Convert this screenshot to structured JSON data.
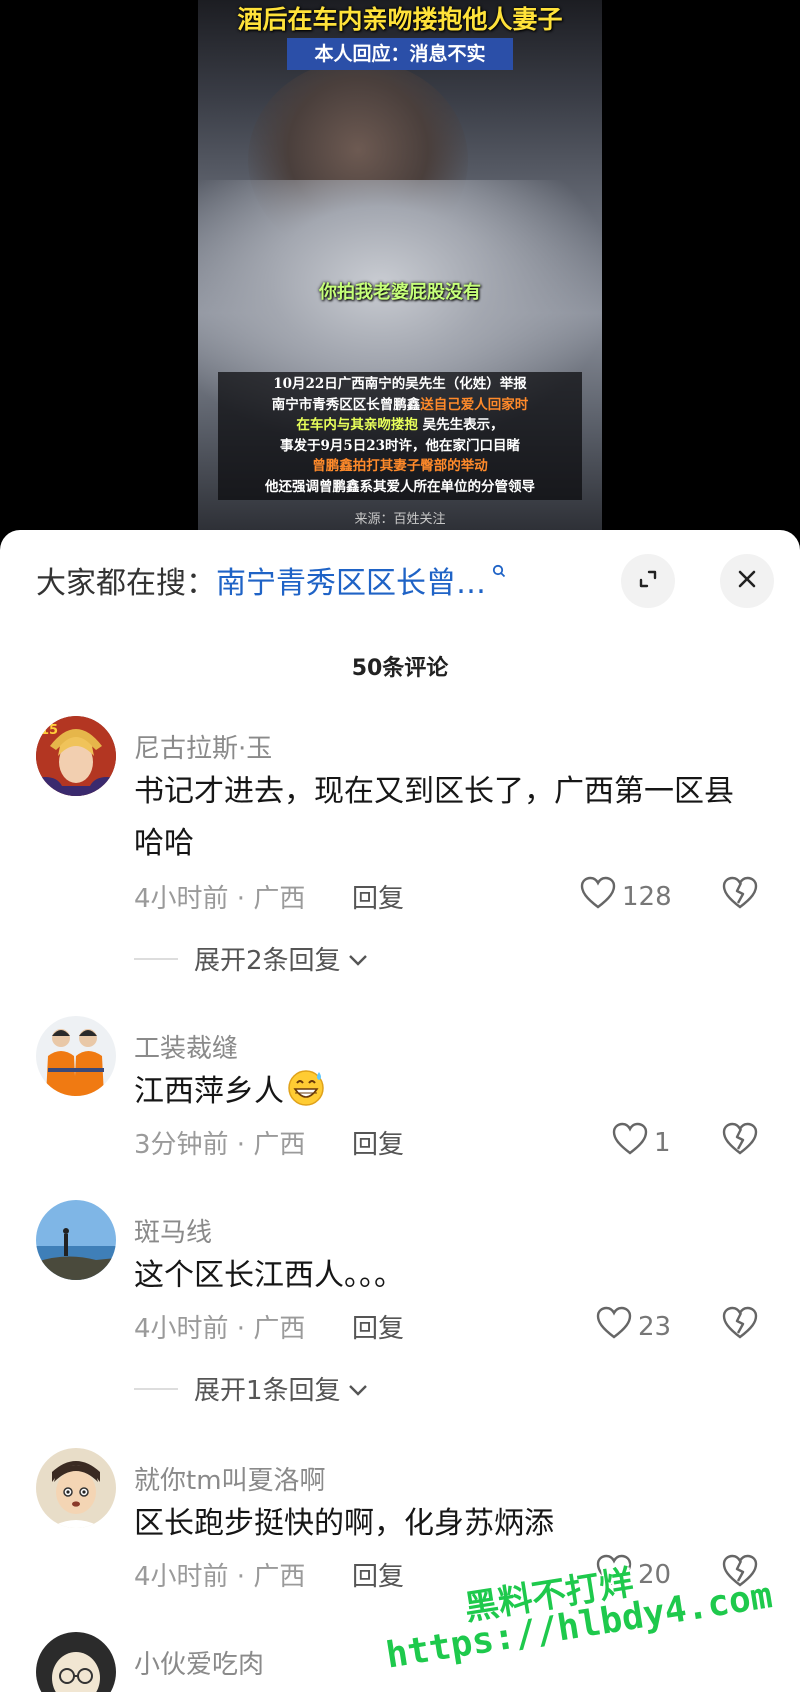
{
  "video": {
    "title": "酒后在车内亲吻搂抱他人妻子",
    "subtitle": "本人回应：消息不实",
    "caption": "你拍我老婆屁股没有",
    "news": {
      "line1": "10月22日广西南宁的吴先生（化姓）举报",
      "line2a": "南宁市青秀区区长曾鹏鑫",
      "line2b": "送自己爱人回家时",
      "line3a": "在车内与其亲吻搂抱",
      "line3b": " 吴先生表示，",
      "line4": "事发于9月5日23时许，他在家门口目睹",
      "line5": "曾鹏鑫拍打其妻子臀部的举动",
      "line6": "他还强调曾鹏鑫系其爱人所在单位的分管领导"
    },
    "source": "来源：百姓关注"
  },
  "search": {
    "label": "大家都在搜：",
    "query": "南宁青秀区区长曾…"
  },
  "comments_count": "50条评论",
  "comments": [
    {
      "user": "尼古拉斯·玉",
      "text": "书记才进去，现在又到区长了，广西第一区县哈哈",
      "time": "4小时前 · 广西",
      "reply": "回复",
      "likes": "128",
      "expand": "展开2条回复"
    },
    {
      "user": "工装裁缝",
      "text": "江西萍乡人",
      "time": "3分钟前 · 广西",
      "reply": "回复",
      "likes": "1",
      "emoji": "grinning-sweat-emoji"
    },
    {
      "user": "斑马线",
      "text": "这个区长江西人。。。",
      "time": "4小时前 · 广西",
      "reply": "回复",
      "likes": "23",
      "expand": "展开1条回复"
    },
    {
      "user": "就你tm叫夏洛啊",
      "text": "区长跑步挺快的啊，化身苏炳添",
      "time": "4小时前 · 广西",
      "reply": "回复",
      "likes": "20"
    },
    {
      "user": "小伙爱吃肉"
    }
  ],
  "watermark": {
    "line1": "黑料不打烊",
    "line2": "https://hlbdy4.com"
  },
  "colors": {
    "link_blue": "#1f63c6",
    "title_yellow": "#ffe23a",
    "caption_green": "#c6ff7a",
    "watermark_green": "#1ec94c"
  }
}
